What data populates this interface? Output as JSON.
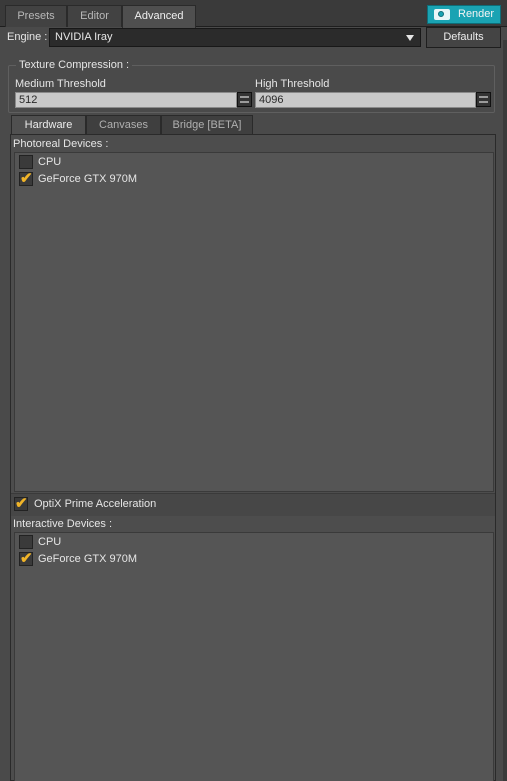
{
  "tabs": [
    {
      "label": "Presets",
      "active": false
    },
    {
      "label": "Editor",
      "active": false
    },
    {
      "label": "Advanced",
      "active": true
    }
  ],
  "render_button": {
    "label": "Render",
    "icon": "camera-icon",
    "color": "#1aa3b3"
  },
  "engine": {
    "label": "Engine :",
    "value": "NVIDIA Iray"
  },
  "defaults_button": {
    "label": "Defaults"
  },
  "texture_compression": {
    "title": "Texture Compression :",
    "medium_label": "Medium Threshold",
    "medium_value": "512",
    "high_label": "High Threshold",
    "high_value": "4096"
  },
  "subtabs": [
    {
      "label": "Hardware",
      "active": true
    },
    {
      "label": "Canvases",
      "active": false
    },
    {
      "label": "Bridge [BETA]",
      "active": false
    }
  ],
  "photoreal": {
    "title": "Photoreal Devices :",
    "devices": [
      {
        "label": "CPU",
        "checked": false
      },
      {
        "label": "GeForce GTX 970M",
        "checked": true
      }
    ]
  },
  "optix": {
    "label": "OptiX Prime Acceleration",
    "checked": true
  },
  "interactive": {
    "title": "Interactive Devices :",
    "devices": [
      {
        "label": "CPU",
        "checked": false
      },
      {
        "label": "GeForce GTX 970M",
        "checked": true
      }
    ]
  },
  "colors": {
    "accent": "#1aa3b3",
    "check": "#f0b428"
  }
}
